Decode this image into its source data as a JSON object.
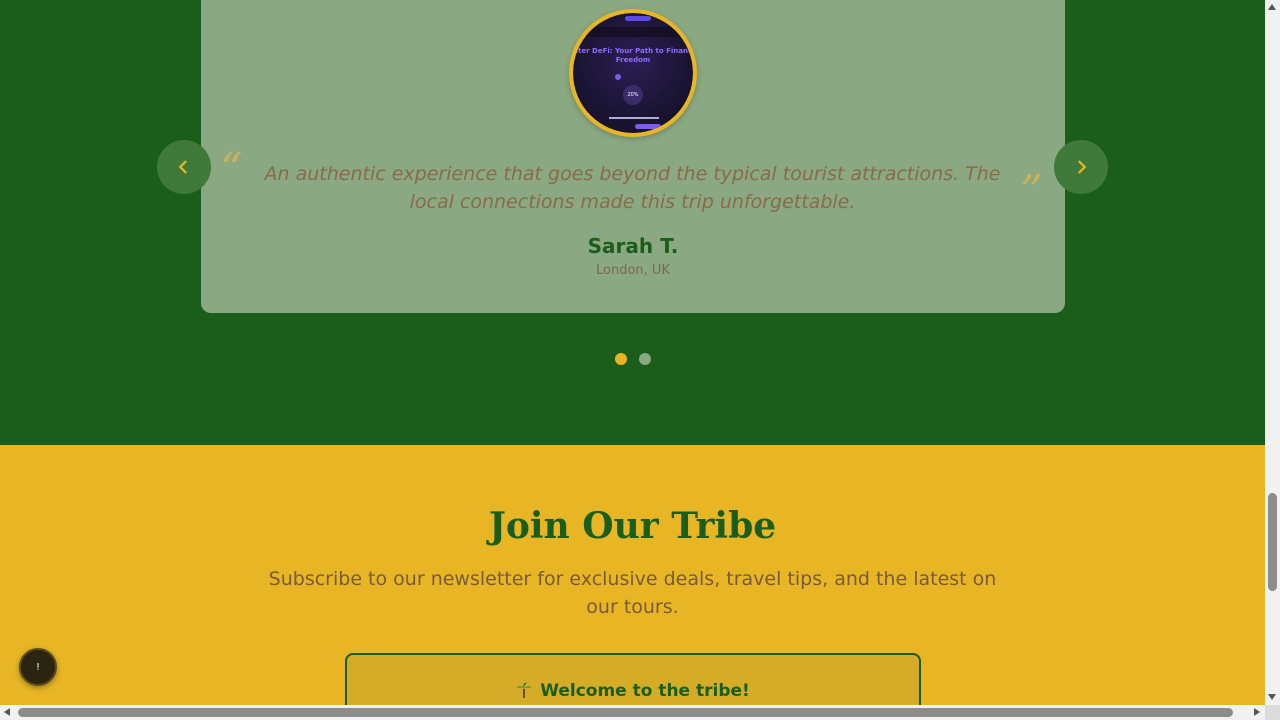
{
  "testimonials": {
    "quote_open": "“",
    "quote_close": "”",
    "quote": "An authentic experience that goes beyond the typical tourist attractions. The local connections made this trip unforgettable.",
    "author": "Sarah T.",
    "location": "London, UK",
    "avatar_preview": {
      "title": "ster DeFi: Your Path to Financ Freedom",
      "badge": "20%"
    },
    "prev_icon": "chevron-left-icon",
    "next_icon": "chevron-right-icon",
    "active_slide": 1,
    "slide_count": 2
  },
  "newsletter": {
    "title": "Join Our Tribe",
    "subtitle": "Subscribe to our newsletter for exclusive deals, travel tips, and the latest on our tours.",
    "welcome_message": "Welcome to the tribe!",
    "welcome_icon": "palm-tree-icon"
  },
  "floating_button": {
    "label": "!"
  },
  "colors": {
    "forest_green": "#1b5e1b",
    "card_sage": "#8aa882",
    "accent_gold": "#e8b624",
    "text_brown": "#8a6a4a"
  }
}
